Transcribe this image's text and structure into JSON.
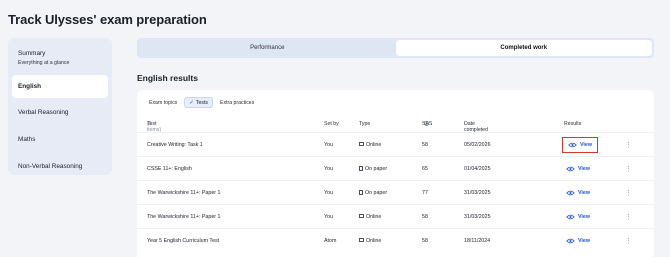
{
  "page": {
    "title": "Track Ulysses' exam preparation"
  },
  "sidebar": {
    "items": [
      {
        "label": "Summary",
        "sub": "Everything at a glance"
      },
      {
        "label": "English"
      },
      {
        "label": "Verbal Reasoning"
      },
      {
        "label": "Maths"
      },
      {
        "label": "Non-Verbal Reasoning"
      }
    ]
  },
  "toggle": {
    "performance": "Performance",
    "completed": "Completed work"
  },
  "section": {
    "title": "English results"
  },
  "filters": {
    "exam_topics": "Exam topics",
    "tests": "Tests",
    "extra_practices": "Extra practices"
  },
  "table": {
    "headers": {
      "test": "Test",
      "test_count": "(6 items)",
      "set_by": "Set by",
      "type": "Type",
      "sas": "SAS",
      "date": "Date completed",
      "results": "Results"
    },
    "rows": [
      {
        "test": "Creative Writing: Task 1",
        "set_by": "You",
        "type": "Online",
        "sas": "58",
        "date": "05/02/2026",
        "view": "View"
      },
      {
        "test": "CSSE 11+: English",
        "set_by": "You",
        "type": "On paper",
        "sas": "65",
        "date": "01/04/2025",
        "view": "View"
      },
      {
        "test": "The Warwickshire 11+: Paper 1",
        "set_by": "You",
        "type": "On paper",
        "sas": "77",
        "date": "31/03/2025",
        "view": "View"
      },
      {
        "test": "The Warwickshire 11+: Paper 1",
        "set_by": "You",
        "type": "Online",
        "sas": "58",
        "date": "31/03/2025",
        "view": "View"
      },
      {
        "test": "Year 5 English Curriculum Test",
        "set_by": "Atom",
        "type": "Online",
        "sas": "58",
        "date": "18/11/2024",
        "view": "View"
      }
    ]
  },
  "colors": {
    "accent": "#2456d6",
    "highlight": "#d3382c",
    "background": "#f2f4f8"
  },
  "icons": {
    "online": "laptop-icon",
    "paper": "document-icon",
    "view": "eye-icon",
    "more": "kebab-icon",
    "sort": "sort-down-icon",
    "info": "info-icon",
    "check": "check-icon"
  }
}
